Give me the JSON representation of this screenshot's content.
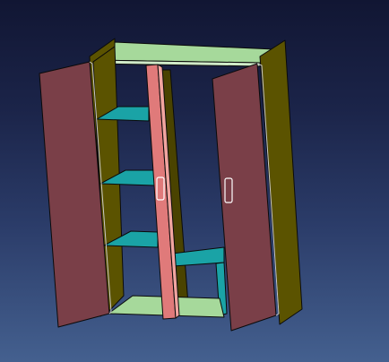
{
  "viewport": {
    "background_top": "#111633",
    "background_bottom": "#44608f"
  },
  "model": {
    "name": "",
    "colors": {
      "door": "#7a3f48",
      "door_edge": "#a85a63",
      "side_panel": "#5b5300",
      "side_panel_light": "#6e6605",
      "top_bottom_board": "#a6d99b",
      "shelf": "#1aa3a6",
      "shelf_edge": "#6ad6d4",
      "partition": "#e07a7a",
      "outline": "#0a0a0a",
      "highlight": "#ffffff"
    }
  }
}
